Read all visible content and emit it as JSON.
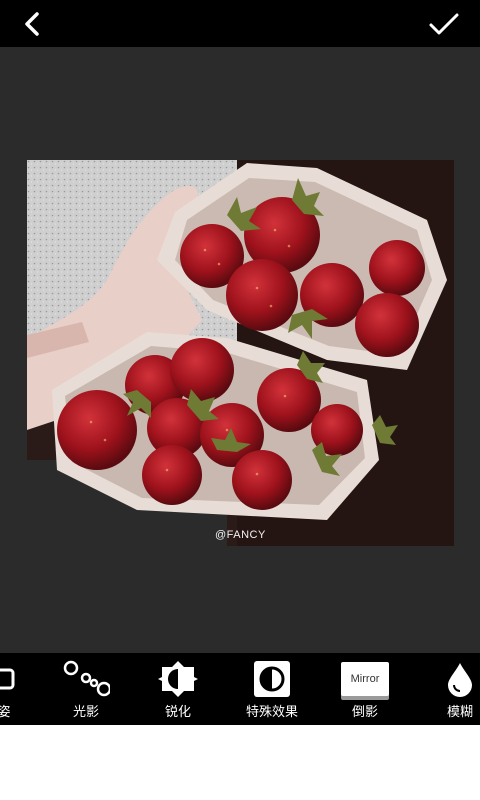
{
  "header": {
    "back_icon": "chevron-left-icon",
    "confirm_icon": "checkmark-icon"
  },
  "photo": {
    "watermark": "@FANCY"
  },
  "toolbar": {
    "items": [
      {
        "label": "姿",
        "icon": "square-outline-icon"
      },
      {
        "label": "光影",
        "icon": "light-dots-icon"
      },
      {
        "label": "锐化",
        "icon": "sharpen-icon"
      },
      {
        "label": "特殊效果",
        "icon": "contrast-icon"
      },
      {
        "label": "倒影",
        "icon": "mirror-icon",
        "chip_text": "Mirror",
        "active": true
      },
      {
        "label": "模糊",
        "icon": "drop-icon"
      }
    ]
  },
  "colors": {
    "bar": "#000000",
    "canvas": "#2b2b2b"
  }
}
